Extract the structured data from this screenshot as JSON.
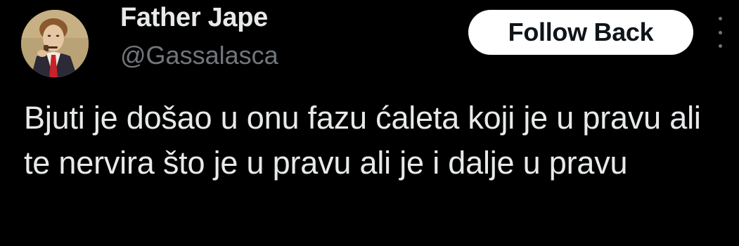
{
  "author": {
    "display_name": "Father Jape",
    "handle": "@Gassalasca",
    "avatar_icon": "portrait-avatar"
  },
  "actions": {
    "follow_label": "Follow Back",
    "more_icon": "more-vertical-icon"
  },
  "tweet": {
    "text": "Bjuti je došao u onu fazu ćaleta koji je u pravu ali te nervira što je u pravu ali je i dalje u pravu"
  },
  "colors": {
    "background": "#000000",
    "primary_text": "#e7e9ea",
    "secondary_text": "#71767b",
    "button_bg": "#ffffff",
    "button_text": "#0f1419"
  }
}
